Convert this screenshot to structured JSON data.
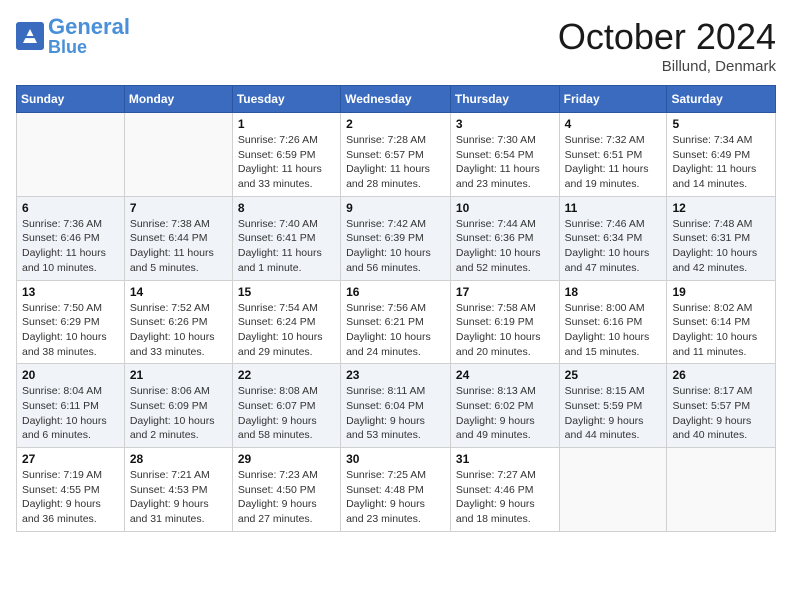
{
  "header": {
    "logo_general": "General",
    "logo_blue": "Blue",
    "month_title": "October 2024",
    "location": "Billund, Denmark"
  },
  "days_of_week": [
    "Sunday",
    "Monday",
    "Tuesday",
    "Wednesday",
    "Thursday",
    "Friday",
    "Saturday"
  ],
  "weeks": [
    [
      {
        "day": "",
        "info": ""
      },
      {
        "day": "",
        "info": ""
      },
      {
        "day": "1",
        "sunrise": "Sunrise: 7:26 AM",
        "sunset": "Sunset: 6:59 PM",
        "daylight": "Daylight: 11 hours and 33 minutes."
      },
      {
        "day": "2",
        "sunrise": "Sunrise: 7:28 AM",
        "sunset": "Sunset: 6:57 PM",
        "daylight": "Daylight: 11 hours and 28 minutes."
      },
      {
        "day": "3",
        "sunrise": "Sunrise: 7:30 AM",
        "sunset": "Sunset: 6:54 PM",
        "daylight": "Daylight: 11 hours and 23 minutes."
      },
      {
        "day": "4",
        "sunrise": "Sunrise: 7:32 AM",
        "sunset": "Sunset: 6:51 PM",
        "daylight": "Daylight: 11 hours and 19 minutes."
      },
      {
        "day": "5",
        "sunrise": "Sunrise: 7:34 AM",
        "sunset": "Sunset: 6:49 PM",
        "daylight": "Daylight: 11 hours and 14 minutes."
      }
    ],
    [
      {
        "day": "6",
        "sunrise": "Sunrise: 7:36 AM",
        "sunset": "Sunset: 6:46 PM",
        "daylight": "Daylight: 11 hours and 10 minutes."
      },
      {
        "day": "7",
        "sunrise": "Sunrise: 7:38 AM",
        "sunset": "Sunset: 6:44 PM",
        "daylight": "Daylight: 11 hours and 5 minutes."
      },
      {
        "day": "8",
        "sunrise": "Sunrise: 7:40 AM",
        "sunset": "Sunset: 6:41 PM",
        "daylight": "Daylight: 11 hours and 1 minute."
      },
      {
        "day": "9",
        "sunrise": "Sunrise: 7:42 AM",
        "sunset": "Sunset: 6:39 PM",
        "daylight": "Daylight: 10 hours and 56 minutes."
      },
      {
        "day": "10",
        "sunrise": "Sunrise: 7:44 AM",
        "sunset": "Sunset: 6:36 PM",
        "daylight": "Daylight: 10 hours and 52 minutes."
      },
      {
        "day": "11",
        "sunrise": "Sunrise: 7:46 AM",
        "sunset": "Sunset: 6:34 PM",
        "daylight": "Daylight: 10 hours and 47 minutes."
      },
      {
        "day": "12",
        "sunrise": "Sunrise: 7:48 AM",
        "sunset": "Sunset: 6:31 PM",
        "daylight": "Daylight: 10 hours and 42 minutes."
      }
    ],
    [
      {
        "day": "13",
        "sunrise": "Sunrise: 7:50 AM",
        "sunset": "Sunset: 6:29 PM",
        "daylight": "Daylight: 10 hours and 38 minutes."
      },
      {
        "day": "14",
        "sunrise": "Sunrise: 7:52 AM",
        "sunset": "Sunset: 6:26 PM",
        "daylight": "Daylight: 10 hours and 33 minutes."
      },
      {
        "day": "15",
        "sunrise": "Sunrise: 7:54 AM",
        "sunset": "Sunset: 6:24 PM",
        "daylight": "Daylight: 10 hours and 29 minutes."
      },
      {
        "day": "16",
        "sunrise": "Sunrise: 7:56 AM",
        "sunset": "Sunset: 6:21 PM",
        "daylight": "Daylight: 10 hours and 24 minutes."
      },
      {
        "day": "17",
        "sunrise": "Sunrise: 7:58 AM",
        "sunset": "Sunset: 6:19 PM",
        "daylight": "Daylight: 10 hours and 20 minutes."
      },
      {
        "day": "18",
        "sunrise": "Sunrise: 8:00 AM",
        "sunset": "Sunset: 6:16 PM",
        "daylight": "Daylight: 10 hours and 15 minutes."
      },
      {
        "day": "19",
        "sunrise": "Sunrise: 8:02 AM",
        "sunset": "Sunset: 6:14 PM",
        "daylight": "Daylight: 10 hours and 11 minutes."
      }
    ],
    [
      {
        "day": "20",
        "sunrise": "Sunrise: 8:04 AM",
        "sunset": "Sunset: 6:11 PM",
        "daylight": "Daylight: 10 hours and 6 minutes."
      },
      {
        "day": "21",
        "sunrise": "Sunrise: 8:06 AM",
        "sunset": "Sunset: 6:09 PM",
        "daylight": "Daylight: 10 hours and 2 minutes."
      },
      {
        "day": "22",
        "sunrise": "Sunrise: 8:08 AM",
        "sunset": "Sunset: 6:07 PM",
        "daylight": "Daylight: 9 hours and 58 minutes."
      },
      {
        "day": "23",
        "sunrise": "Sunrise: 8:11 AM",
        "sunset": "Sunset: 6:04 PM",
        "daylight": "Daylight: 9 hours and 53 minutes."
      },
      {
        "day": "24",
        "sunrise": "Sunrise: 8:13 AM",
        "sunset": "Sunset: 6:02 PM",
        "daylight": "Daylight: 9 hours and 49 minutes."
      },
      {
        "day": "25",
        "sunrise": "Sunrise: 8:15 AM",
        "sunset": "Sunset: 5:59 PM",
        "daylight": "Daylight: 9 hours and 44 minutes."
      },
      {
        "day": "26",
        "sunrise": "Sunrise: 8:17 AM",
        "sunset": "Sunset: 5:57 PM",
        "daylight": "Daylight: 9 hours and 40 minutes."
      }
    ],
    [
      {
        "day": "27",
        "sunrise": "Sunrise: 7:19 AM",
        "sunset": "Sunset: 4:55 PM",
        "daylight": "Daylight: 9 hours and 36 minutes."
      },
      {
        "day": "28",
        "sunrise": "Sunrise: 7:21 AM",
        "sunset": "Sunset: 4:53 PM",
        "daylight": "Daylight: 9 hours and 31 minutes."
      },
      {
        "day": "29",
        "sunrise": "Sunrise: 7:23 AM",
        "sunset": "Sunset: 4:50 PM",
        "daylight": "Daylight: 9 hours and 27 minutes."
      },
      {
        "day": "30",
        "sunrise": "Sunrise: 7:25 AM",
        "sunset": "Sunset: 4:48 PM",
        "daylight": "Daylight: 9 hours and 23 minutes."
      },
      {
        "day": "31",
        "sunrise": "Sunrise: 7:27 AM",
        "sunset": "Sunset: 4:46 PM",
        "daylight": "Daylight: 9 hours and 18 minutes."
      },
      {
        "day": "",
        "info": ""
      },
      {
        "day": "",
        "info": ""
      }
    ]
  ]
}
